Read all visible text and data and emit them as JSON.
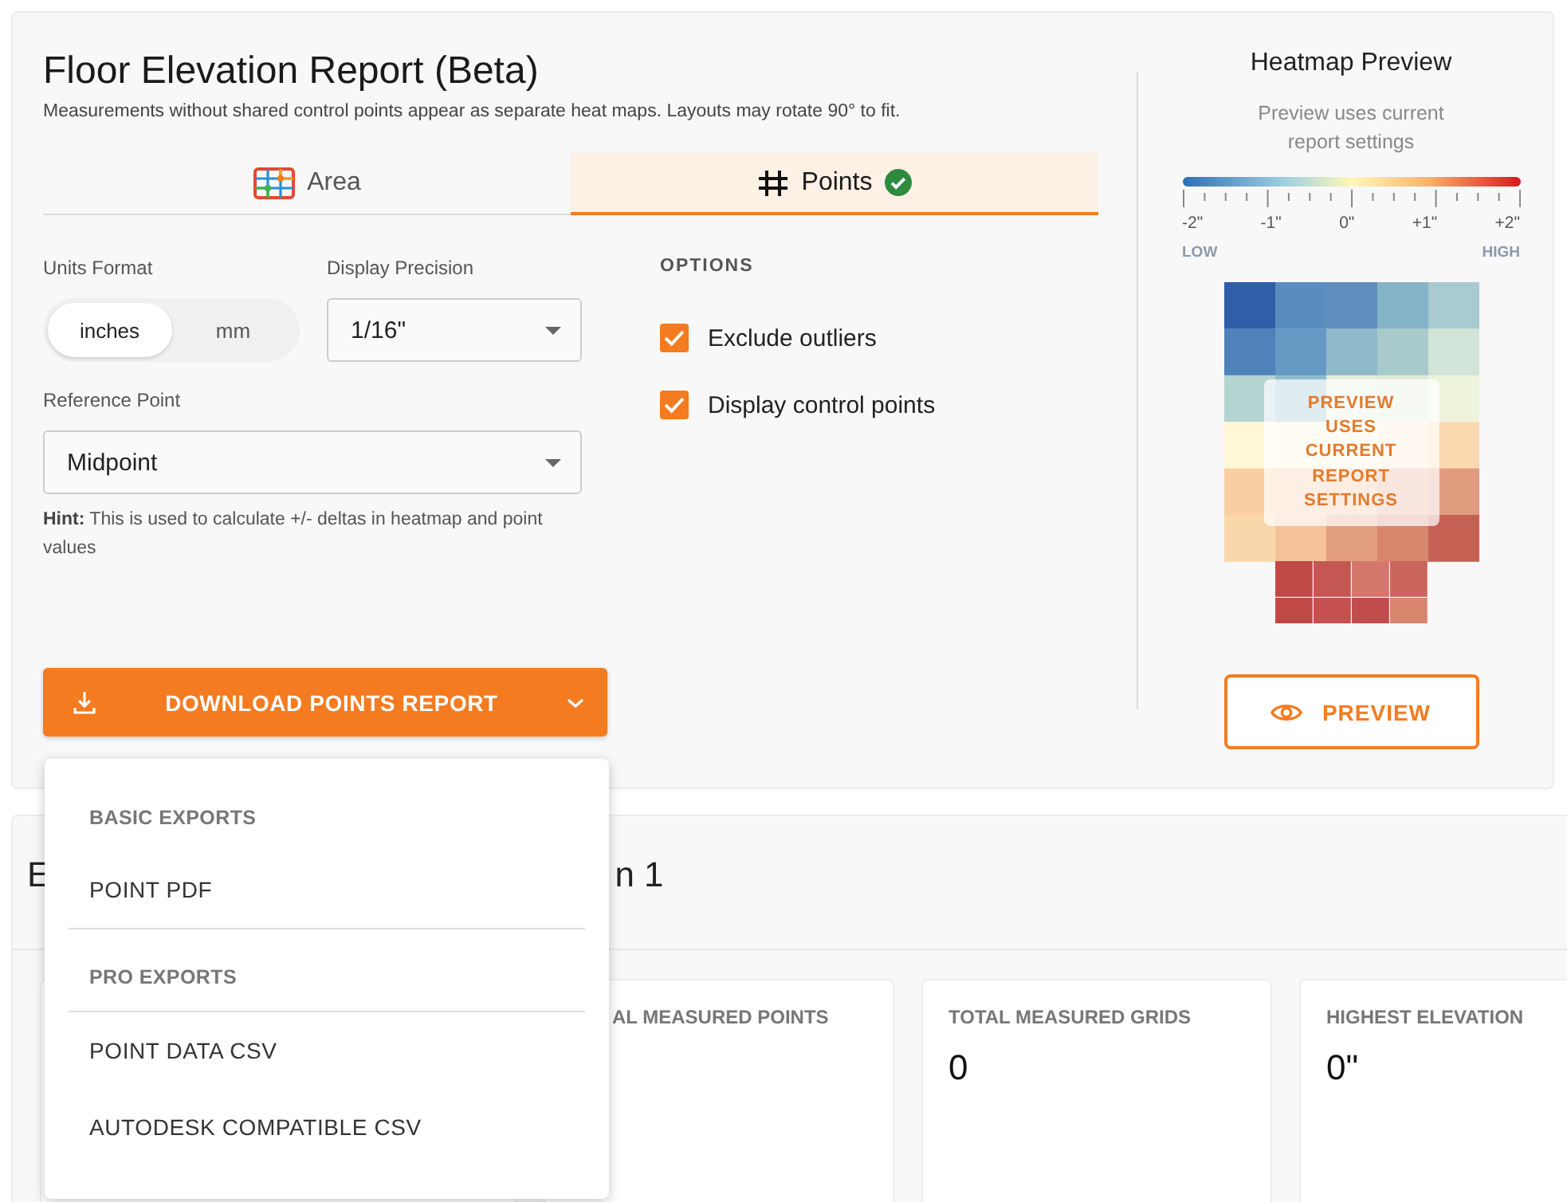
{
  "title": "Floor Elevation Report (Beta)",
  "subtitle": "Measurements without shared control points appear as separate heat maps. Layouts may rotate 90° to fit.",
  "tabs": [
    {
      "label": "Area",
      "kind": "area",
      "selected": false,
      "complete": false
    },
    {
      "label": "Points",
      "kind": "points",
      "selected": true,
      "complete": true
    }
  ],
  "units": {
    "label": "Units Format",
    "options": [
      {
        "label": "inches",
        "selected": true
      },
      {
        "label": "mm",
        "selected": false
      }
    ]
  },
  "precision": {
    "label": "Display Precision",
    "value": "1/16\""
  },
  "reference": {
    "label": "Reference Point",
    "value": "Midpoint"
  },
  "hint": "**Hint:** This is used to calculate +/- deltas in heatmap and point values",
  "options": {
    "heading": "OPTIONS",
    "items": [
      {
        "label": "Exclude outliers",
        "checked": true
      },
      {
        "label": "Display control points",
        "checked": true
      }
    ]
  },
  "download": {
    "label": "DOWNLOAD POINTS REPORT",
    "expanded": true
  },
  "menu": {
    "sections": [
      {
        "heading": "BASIC EXPORTS",
        "items": [
          "POINT PDF"
        ]
      },
      {
        "heading": "PRO EXPORTS",
        "items": [
          "POINT DATA CSV",
          "AUTODESK COMPATIBLE CSV"
        ]
      }
    ]
  },
  "preview": {
    "title": "Heatmap Preview",
    "subtitle": "Preview uses current report settings",
    "scale_labels": [
      "-2\"",
      "-1\"",
      "0\"",
      "+1\"",
      "+2\""
    ],
    "low": "LOW",
    "high": "HIGH",
    "overlay": "PREVIEW USES CURRENT REPORT SETTINGS",
    "button": "PREVIEW"
  },
  "results": {
    "heading_parts": [
      "E",
      "n 1"
    ],
    "cards": [
      {
        "kind": "covered"
      },
      {
        "kind": "partly_covered",
        "label": "AL MEASURED POINTS"
      },
      {
        "kind": "stat",
        "label": "TOTAL MEASURED GRIDS",
        "value": "0"
      },
      {
        "kind": "stat",
        "label": "HIGHEST ELEVATION",
        "value": "0\""
      }
    ]
  }
}
